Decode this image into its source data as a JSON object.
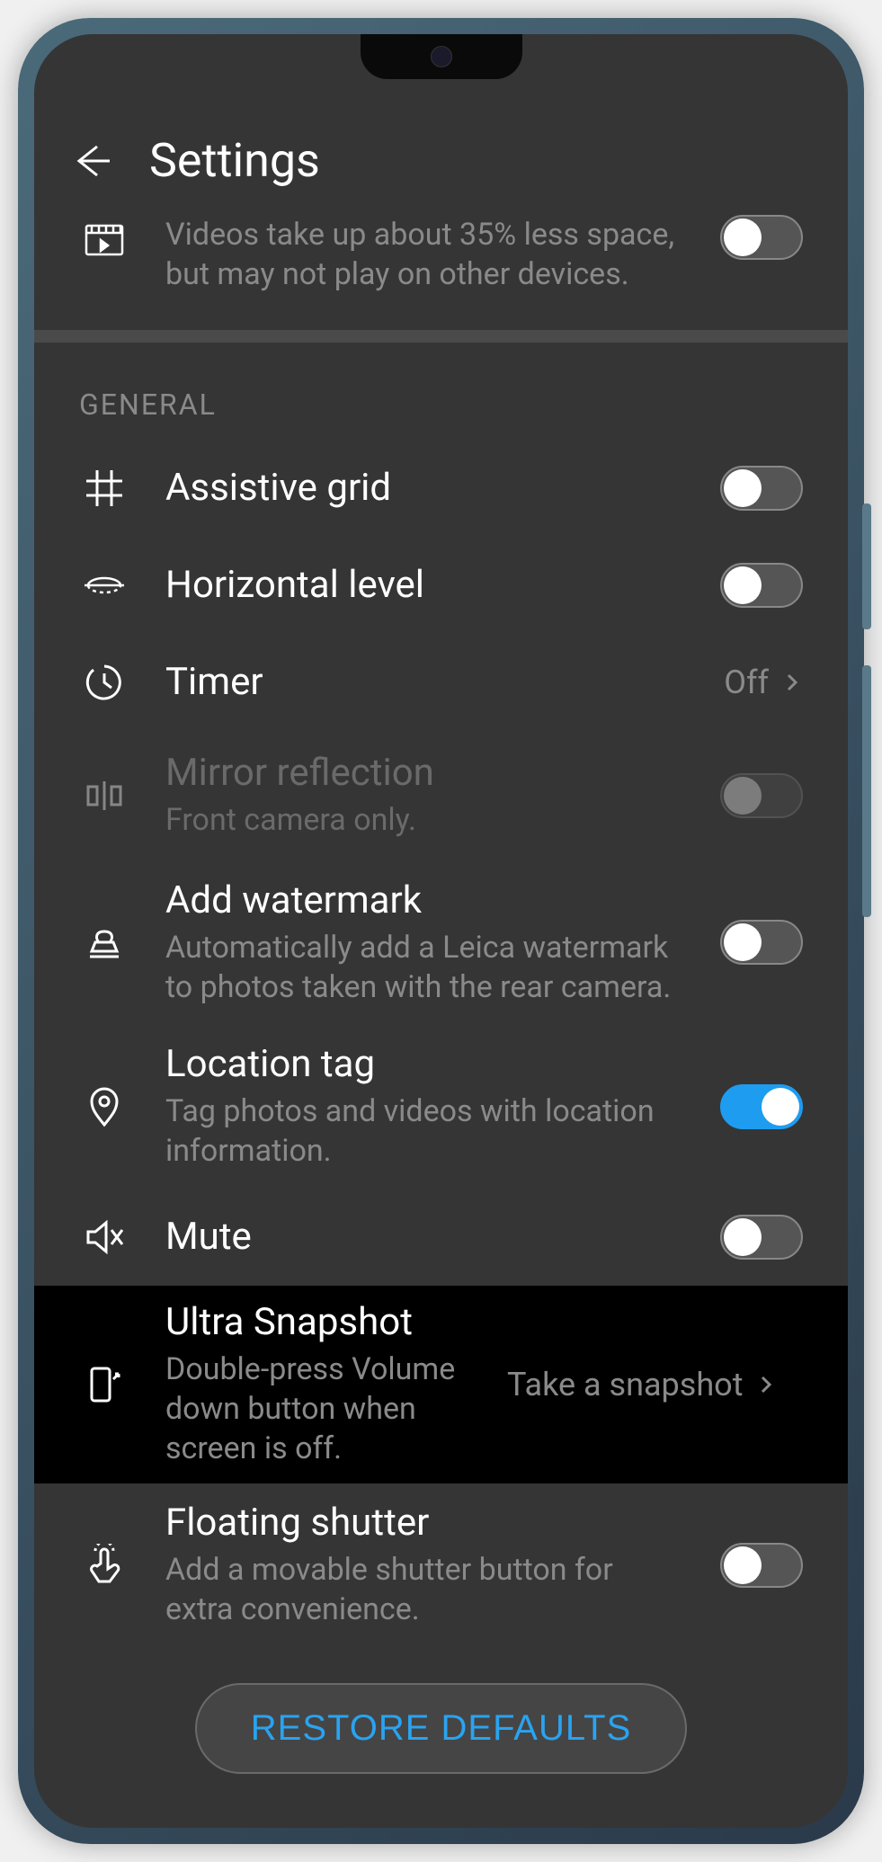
{
  "header": {
    "title": "Settings"
  },
  "top_item": {
    "subtitle": "Videos take up about 35% less space, but may not play on other devices.",
    "toggle": false
  },
  "section": {
    "label": "GENERAL"
  },
  "items": {
    "grid": {
      "title": "Assistive grid",
      "toggle": false
    },
    "level": {
      "title": "Horizontal level",
      "toggle": false
    },
    "timer": {
      "title": "Timer",
      "value": "Off"
    },
    "mirror": {
      "title": "Mirror reflection",
      "subtitle": "Front camera only.",
      "toggle": false,
      "disabled": true
    },
    "watermark": {
      "title": "Add watermark",
      "subtitle": "Automatically add a Leica watermark to photos taken with the rear camera.",
      "toggle": false
    },
    "location": {
      "title": "Location tag",
      "subtitle": "Tag photos and videos with location information.",
      "toggle": true
    },
    "mute": {
      "title": "Mute",
      "toggle": false
    },
    "ultra": {
      "title": "Ultra Snapshot",
      "subtitle": "Double-press Volume down button when screen is off.",
      "value": "Take a snapshot"
    },
    "floating": {
      "title": "Floating shutter",
      "subtitle": "Add a movable shutter button for extra convenience.",
      "toggle": false
    }
  },
  "restore": {
    "label": "RESTORE DEFAULTS"
  }
}
